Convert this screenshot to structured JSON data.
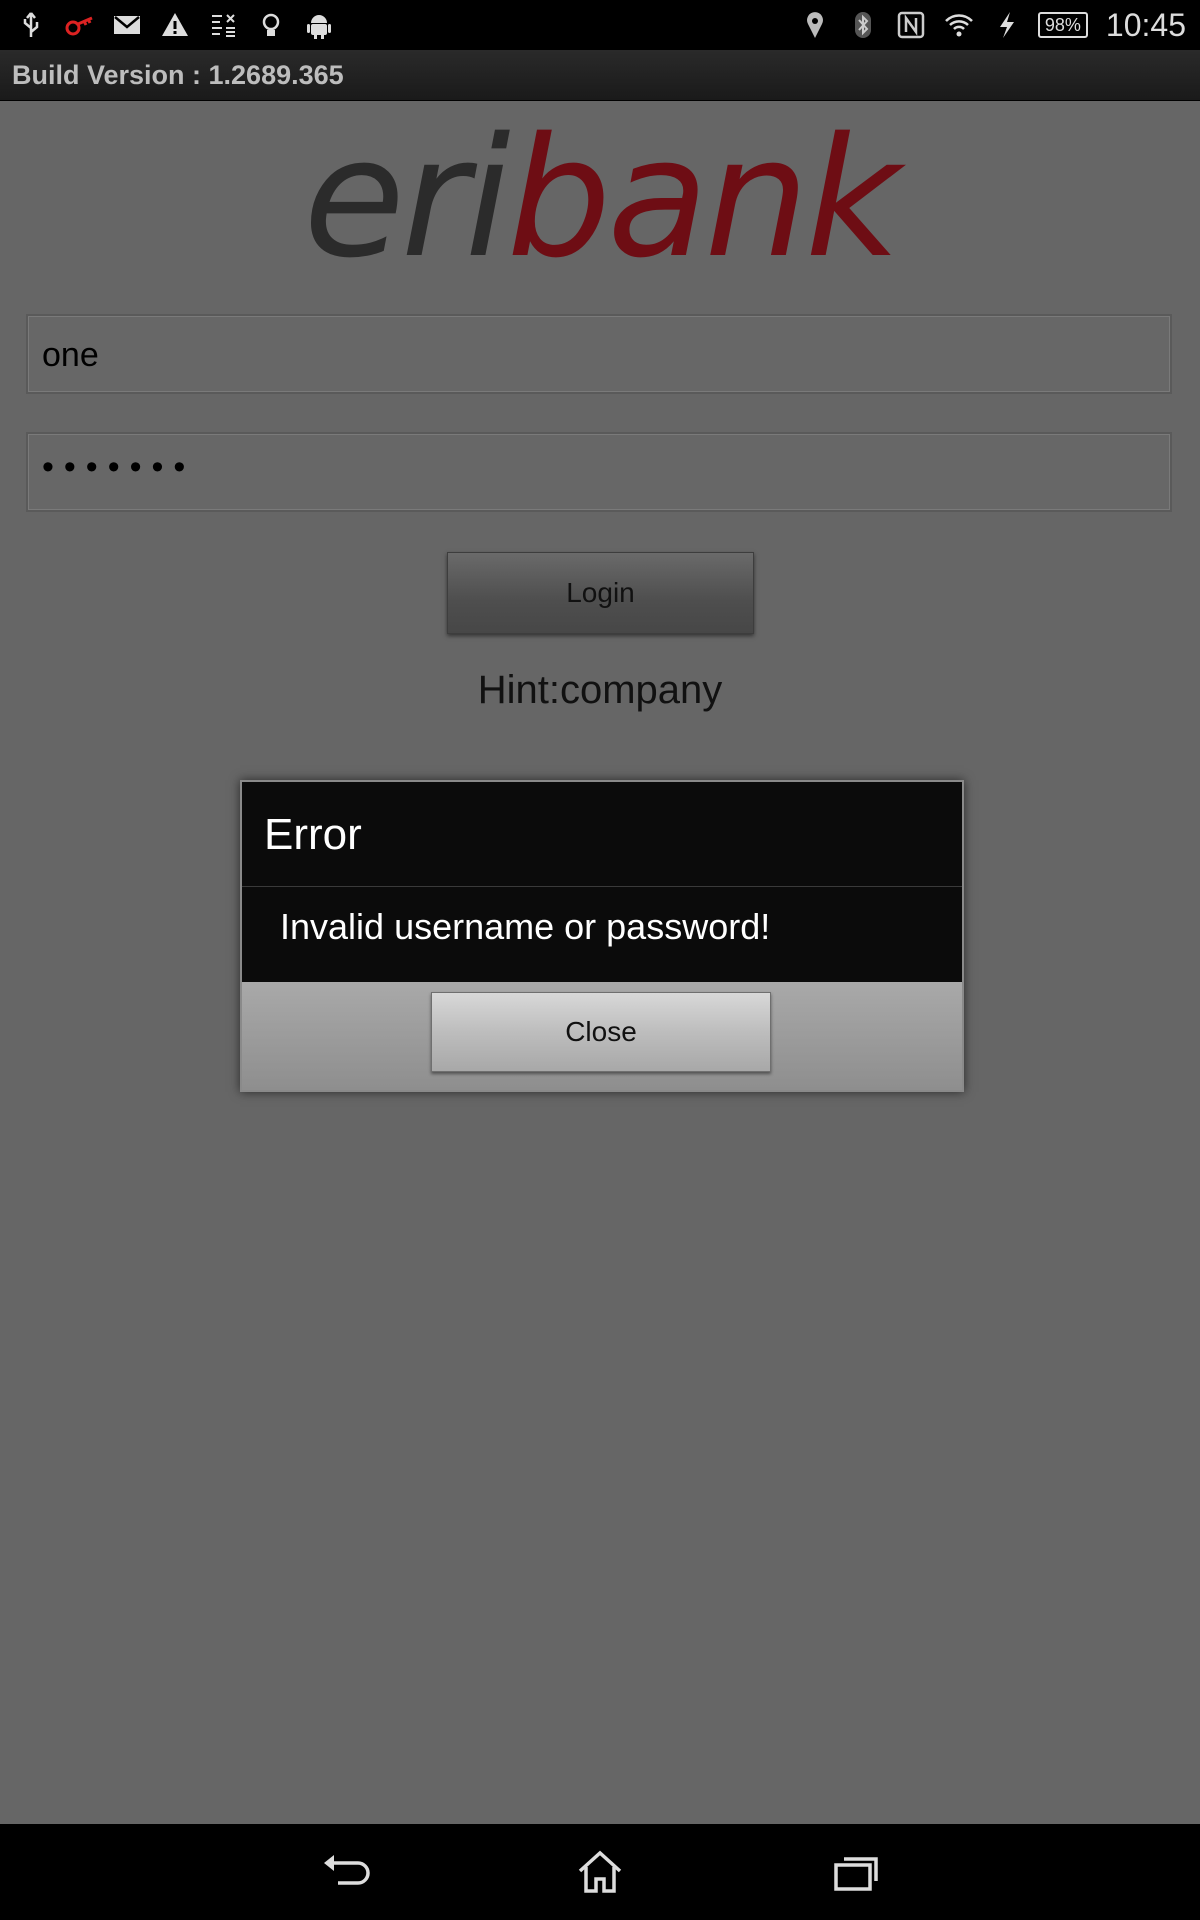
{
  "status_bar": {
    "battery": "98%",
    "time": "10:45",
    "left_icons": [
      "usb-icon",
      "red-key-icon",
      "gmail-icon",
      "warning-icon",
      "text-list-icon",
      "lightbulb-icon",
      "android-icon"
    ],
    "right_icons": [
      "location-icon",
      "bluetooth-icon",
      "nfc-icon",
      "wifi-icon",
      "charging-icon"
    ]
  },
  "build": {
    "label": "Build Version : 1.2689.365"
  },
  "logo": {
    "part1": "eri",
    "part2": "bank",
    "color_dark": "#2b2b2b",
    "color_brand": "#6e0d14"
  },
  "form": {
    "username_value": "one",
    "password_mask": "•••••••",
    "login_label": "Login",
    "hint": "Hint:company"
  },
  "dialog": {
    "title": "Error",
    "message": "Invalid username or password!",
    "close_label": "Close"
  },
  "nav": {
    "buttons": [
      "back-icon",
      "home-icon",
      "recent-apps-icon"
    ]
  }
}
